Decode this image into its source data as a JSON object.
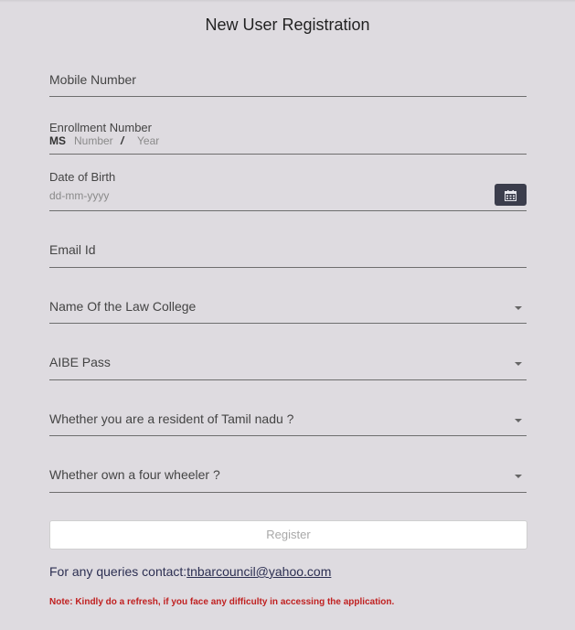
{
  "title": "New User Registration",
  "fields": {
    "mobile": {
      "label": "Mobile Number"
    },
    "enrollment": {
      "label": "Enrollment Number",
      "prefix": "MS",
      "number_placeholder": "Number",
      "separator": "/",
      "year_placeholder": "Year"
    },
    "dob": {
      "label": "Date of Birth",
      "placeholder": "dd-mm-yyyy",
      "icon": "calendar-icon"
    },
    "email": {
      "label": "Email Id"
    },
    "law_college": {
      "label": "Name Of the Law College"
    },
    "aibe": {
      "label": "AIBE Pass"
    },
    "resident": {
      "label": "Whether you are a resident of Tamil nadu ?"
    },
    "four_wheeler": {
      "label": "Whether own a four wheeler ?"
    }
  },
  "register_button": {
    "label": "Register"
  },
  "contact": {
    "prefix": "For any queries contact:",
    "email": "tnbarcouncil@yahoo.com"
  },
  "note": "Note: Kindly do a refresh, if you face any difficulty in accessing the application.",
  "colors": {
    "background": "#dedbe0",
    "calendar_button": "#3b3d4c",
    "note": "#c02020",
    "link": "#2c2f52"
  }
}
